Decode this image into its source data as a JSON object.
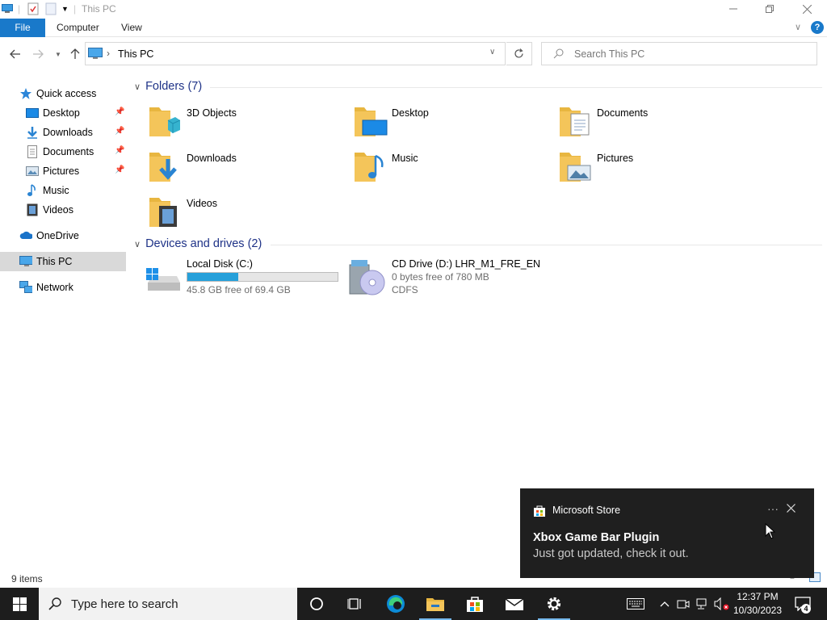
{
  "window": {
    "title": "This PC",
    "ribbon_tabs": [
      "File",
      "Computer",
      "View"
    ]
  },
  "address": {
    "location": "This PC",
    "search_placeholder": "Search This PC"
  },
  "nav_pane": {
    "quick_access": "Quick access",
    "pinned": [
      {
        "label": "Desktop",
        "icon": "desktop-icon",
        "pinned": true
      },
      {
        "label": "Downloads",
        "icon": "downloads-icon",
        "pinned": true
      },
      {
        "label": "Documents",
        "icon": "documents-icon",
        "pinned": true
      },
      {
        "label": "Pictures",
        "icon": "pictures-icon",
        "pinned": true
      },
      {
        "label": "Music",
        "icon": "music-icon",
        "pinned": false
      },
      {
        "label": "Videos",
        "icon": "videos-icon",
        "pinned": false
      }
    ],
    "onedrive": "OneDrive",
    "this_pc": "This PC",
    "network": "Network"
  },
  "folders": {
    "header": "Folders (7)",
    "items": [
      {
        "label": "3D Objects",
        "icon": "3d-objects-folder-icon"
      },
      {
        "label": "Desktop",
        "icon": "desktop-folder-icon"
      },
      {
        "label": "Documents",
        "icon": "documents-folder-icon"
      },
      {
        "label": "Downloads",
        "icon": "downloads-folder-icon"
      },
      {
        "label": "Music",
        "icon": "music-folder-icon"
      },
      {
        "label": "Pictures",
        "icon": "pictures-folder-icon"
      },
      {
        "label": "Videos",
        "icon": "videos-folder-icon"
      }
    ]
  },
  "drives": {
    "header": "Devices and drives (2)",
    "items": [
      {
        "label": "Local Disk (C:)",
        "free": "45.8 GB free of 69.4 GB",
        "used_fraction": 0.34,
        "icon": "local-disk-icon"
      },
      {
        "label": "CD Drive (D:) LHR_M1_FRE_EN",
        "free": "0 bytes free of 780 MB",
        "fs": "CDFS",
        "icon": "cd-drive-icon"
      }
    ]
  },
  "status": {
    "item_count": "9 items"
  },
  "toast": {
    "app": "Microsoft Store",
    "title": "Xbox Game Bar Plugin",
    "body": "Just got updated, check it out."
  },
  "taskbar": {
    "search_placeholder": "Type here to search",
    "time": "12:37 PM",
    "date": "10/30/2023",
    "notification_count": "4"
  },
  "colors": {
    "accent": "#1979ca",
    "group_header": "#1e3287",
    "drive_bar": "#26a0da",
    "folder": "#f4c55a",
    "taskbar": "#1d1d1d",
    "toast": "#1f1f1f"
  }
}
